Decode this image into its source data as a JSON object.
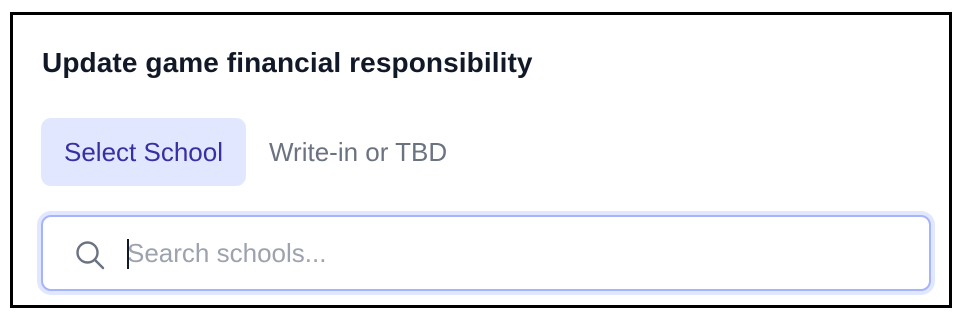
{
  "dialog": {
    "title": "Update game financial responsibility"
  },
  "tabs": [
    {
      "label": "Select School",
      "active": true
    },
    {
      "label": "Write-in or TBD",
      "active": false
    }
  ],
  "search": {
    "value": "",
    "placeholder": "Search schools...",
    "icon": "search-icon"
  },
  "colors": {
    "active_tab_bg": "#e0e7ff",
    "active_tab_text": "#3730a3",
    "inactive_tab_text": "#6b7280",
    "focus_ring": "#a5b4fc"
  }
}
